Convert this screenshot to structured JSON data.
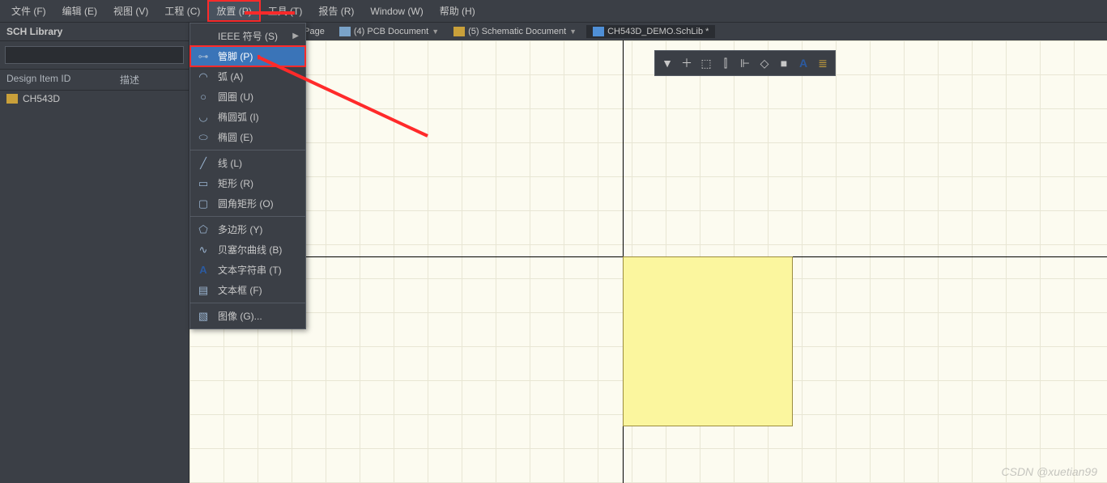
{
  "menu": {
    "file": "文件 (F)",
    "edit": "编辑 (E)",
    "view": "视图 (V)",
    "project": "工程 (C)",
    "place": "放置 (P)",
    "tools": "工具 (T)",
    "reports": "报告 (R)",
    "window": "Window (W)",
    "help": "帮助 (H)"
  },
  "tabs": {
    "page": "e Page",
    "pcb": "(4) PCB Document",
    "sch": "(5) Schematic Document",
    "activeDoc": "CH543D_DEMO.SchLib *"
  },
  "sidebar": {
    "panelTitle": "SCH Library",
    "searchPlaceholder": "",
    "colDesignItem": "Design Item ID",
    "colDesc": "描述",
    "rows": [
      {
        "name": "CH543D"
      }
    ]
  },
  "dropdown": {
    "items": [
      {
        "label": "IEEE 符号 (S)",
        "hasSub": true,
        "icon": ""
      },
      {
        "label": "管脚 (P)",
        "selected": true,
        "icon": "⊶"
      },
      {
        "label": "弧 (A)",
        "icon": "◠"
      },
      {
        "label": "圆圈 (U)",
        "icon": "○"
      },
      {
        "label": "椭圆弧 (I)",
        "icon": "◡"
      },
      {
        "label": "椭圆 (E)",
        "icon": "⬭"
      },
      {
        "sep": true
      },
      {
        "label": "线 (L)",
        "icon": "╱"
      },
      {
        "label": "矩形 (R)",
        "icon": "▭"
      },
      {
        "label": "圆角矩形 (O)",
        "icon": "▢"
      },
      {
        "sep": true
      },
      {
        "label": "多边形 (Y)",
        "icon": "⬠"
      },
      {
        "label": "贝塞尔曲线 (B)",
        "icon": "∿"
      },
      {
        "label": "文本字符串 (T)",
        "icon": "A"
      },
      {
        "label": "文本框 (F)",
        "icon": "▤"
      },
      {
        "sep": true
      },
      {
        "label": "图像 (G)...",
        "icon": "▧"
      }
    ]
  },
  "floatToolbar": {
    "icons": [
      "▼",
      "＋",
      "⬚",
      "⫿",
      "⊩",
      "◇",
      "■",
      "A",
      "≣"
    ]
  },
  "watermark": "CSDN @xuetian99"
}
